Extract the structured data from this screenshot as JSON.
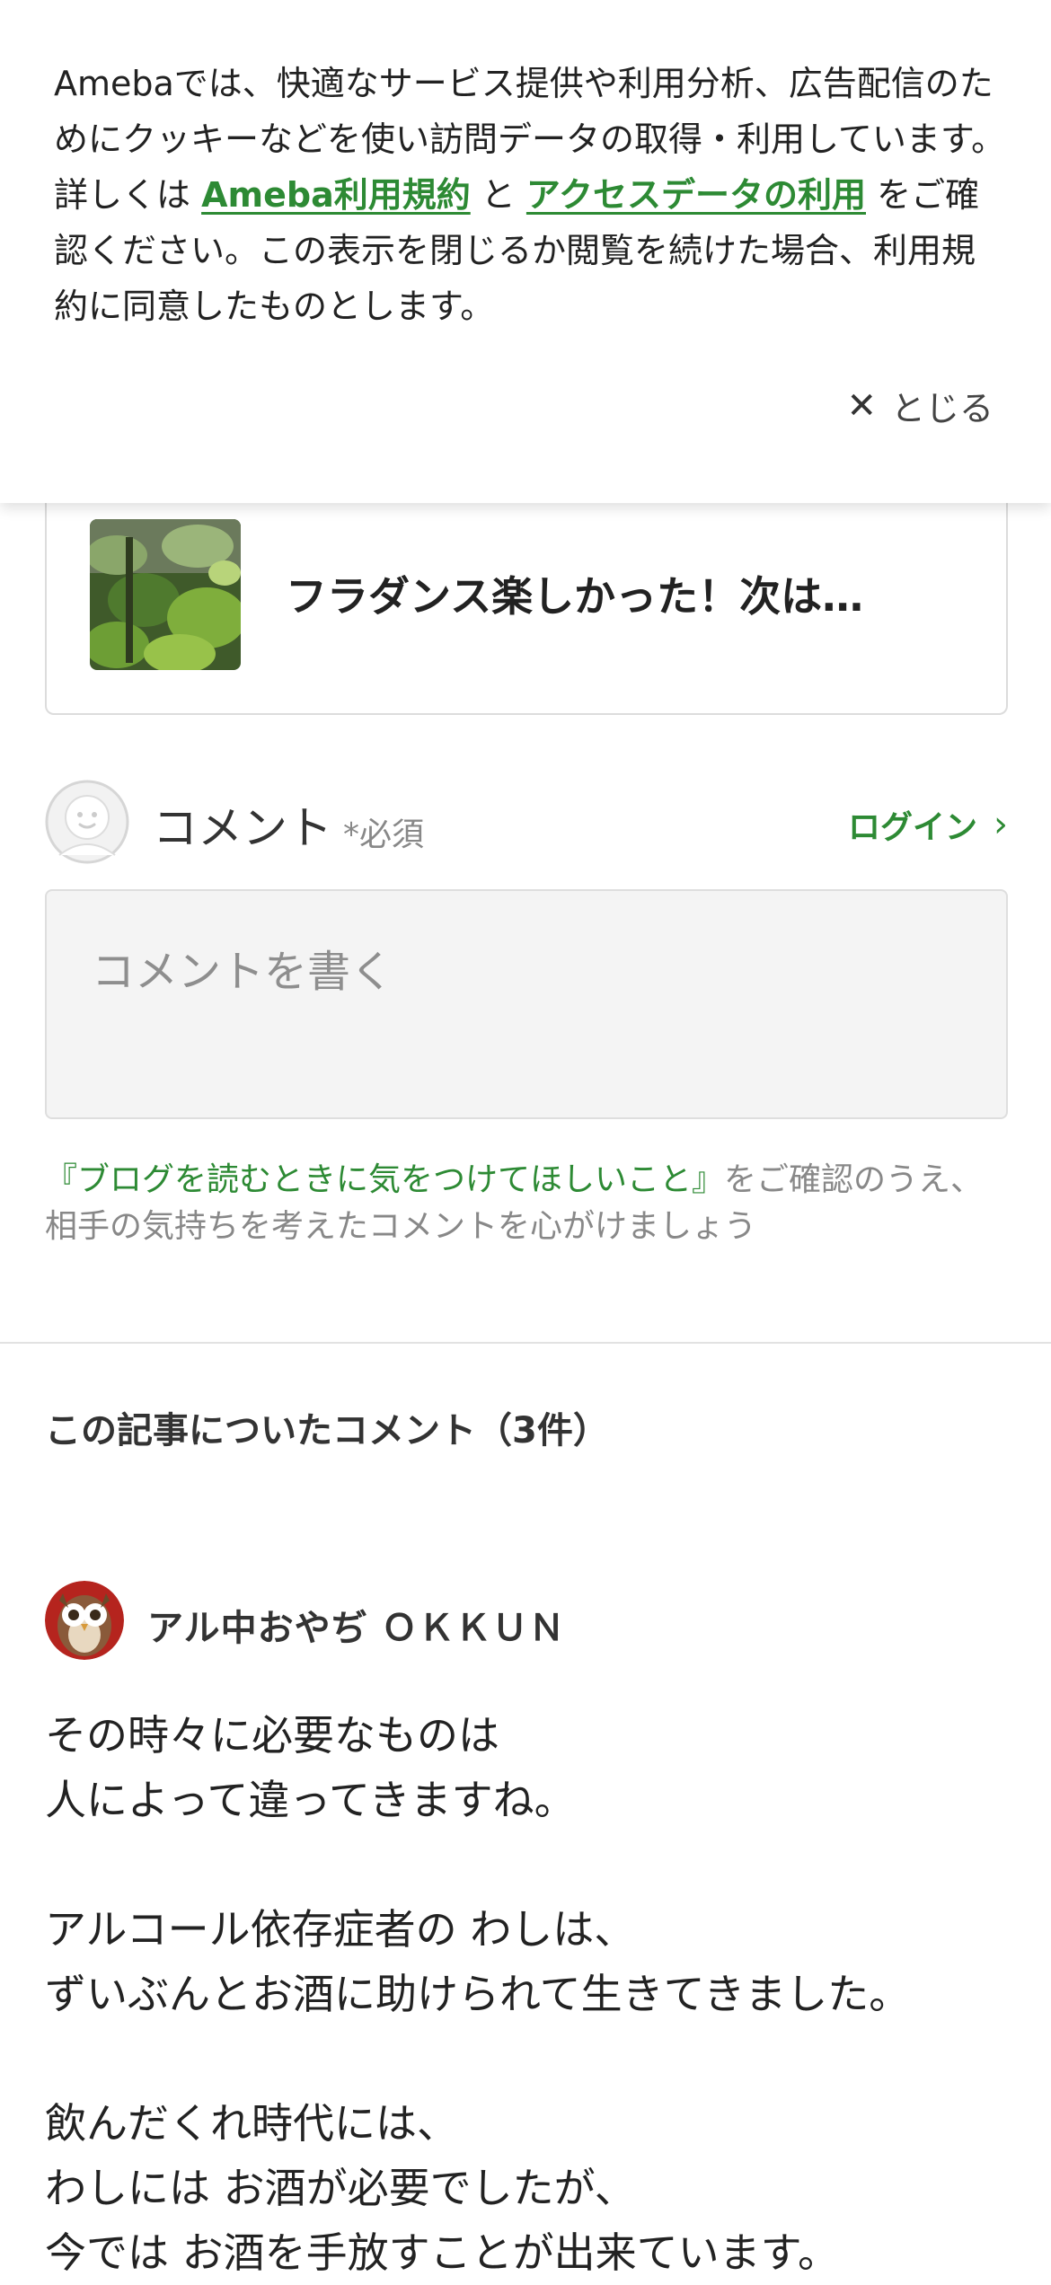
{
  "cookie_banner": {
    "text_before": "Amebaでは、快適なサービス提供や利用分析、広告配信のためにクッキーなどを使い訪問データの取得・利用しています。詳しくは ",
    "link_terms": "Ameba利用規約",
    "text_middle": " と ",
    "link_access": "アクセスデータの利用",
    "text_after": " をご確認ください。この表示を閉じるか閲覧を続けた場合、利用規約に同意したものとします。",
    "close_icon": "close-icon",
    "close_label": "とじる"
  },
  "related_article": {
    "title": "フラダンス楽しかった！次は…"
  },
  "comment_form": {
    "label": "コメント",
    "required": "*必須",
    "login_label": "ログイン",
    "placeholder": "コメントを書く",
    "guideline_link": "『ブログを読むときに気をつけてほしいこと』",
    "guideline_text": "をご確認のうえ、相手の気持ちを考えたコメントを心がけましょう"
  },
  "comments": {
    "heading": "この記事についたコメント（3件）",
    "items": [
      {
        "author": "アル中おやぢ ＯＫＫＵＮ",
        "lines": [
          "その時々に必要なものは",
          "人によって違ってきますね。",
          "",
          "アルコール依存症者の わしは、",
          "ずいぶんとお酒に助けられて生きてきました。",
          "",
          "飲んだくれ時代には、",
          "わしには お酒が必要でしたが、",
          "今では お酒を手放すことが出来ています。"
        ]
      }
    ]
  },
  "colors": {
    "accent_green": "#2d8a34",
    "text_main": "#333333",
    "text_muted": "#888888"
  }
}
